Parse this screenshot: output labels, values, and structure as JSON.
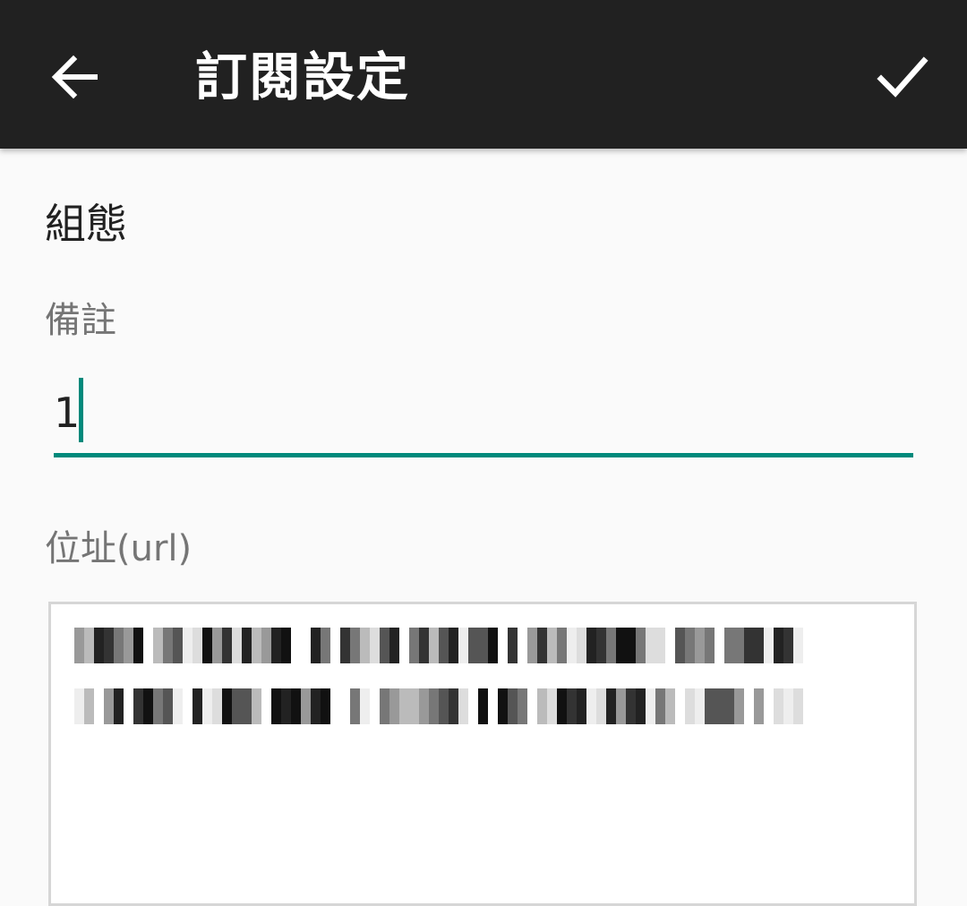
{
  "toolbar": {
    "title": "訂閱設定",
    "back_icon": "arrow-back-icon",
    "confirm_icon": "check-icon",
    "background": "#212121"
  },
  "section": {
    "title": "組態"
  },
  "note": {
    "label": "備註",
    "value": "1",
    "accent": "#00897b"
  },
  "url": {
    "label": "位址(url)"
  },
  "colors": {
    "accent": "#00897b",
    "label_gray": "#757575",
    "text": "#212121"
  }
}
